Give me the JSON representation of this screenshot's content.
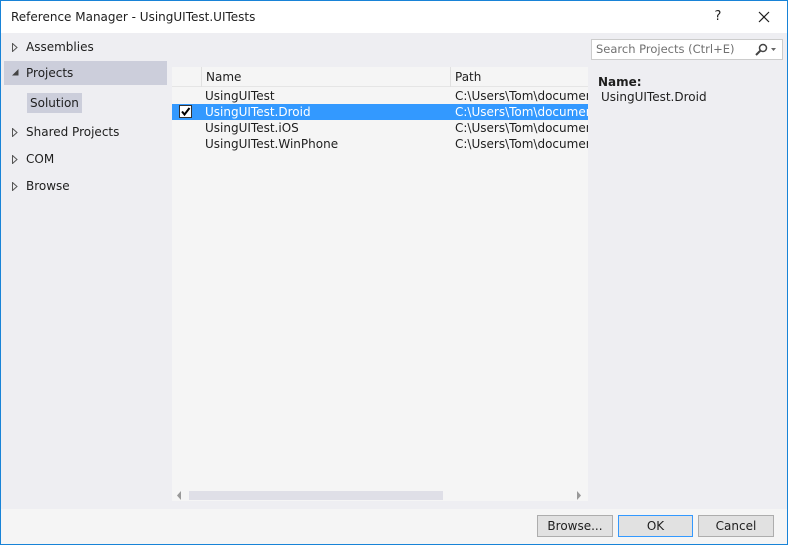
{
  "window": {
    "title": "Reference Manager - UsingUITest.UITests",
    "help_label": "?"
  },
  "sidebar": {
    "items": [
      {
        "label": "Assemblies",
        "expanded": false
      },
      {
        "label": "Projects",
        "expanded": true,
        "children": [
          {
            "label": "Solution",
            "selected": true
          }
        ]
      },
      {
        "label": "Shared Projects",
        "expanded": false
      },
      {
        "label": "COM",
        "expanded": false
      },
      {
        "label": "Browse",
        "expanded": false
      }
    ]
  },
  "grid": {
    "columns": [
      "",
      "Name",
      "Path"
    ],
    "rows": [
      {
        "name": "UsingUITest",
        "path": "C:\\Users\\Tom\\document",
        "checked": false,
        "selected": false
      },
      {
        "name": "UsingUITest.Droid",
        "path": "C:\\Users\\Tom\\document",
        "checked": true,
        "selected": true
      },
      {
        "name": "UsingUITest.iOS",
        "path": "C:\\Users\\Tom\\document",
        "checked": false,
        "selected": false
      },
      {
        "name": "UsingUITest.WinPhone",
        "path": "C:\\Users\\Tom\\document",
        "checked": false,
        "selected": false
      }
    ]
  },
  "search": {
    "placeholder": "Search Projects (Ctrl+E)"
  },
  "details": {
    "name_label": "Name:",
    "name_value": "UsingUITest.Droid"
  },
  "footer": {
    "browse_label": "Browse...",
    "ok_label": "OK",
    "cancel_label": "Cancel"
  },
  "colors": {
    "accent": "#3399ff",
    "border": "#1883d7",
    "selection_bg": "#ccceDB"
  }
}
